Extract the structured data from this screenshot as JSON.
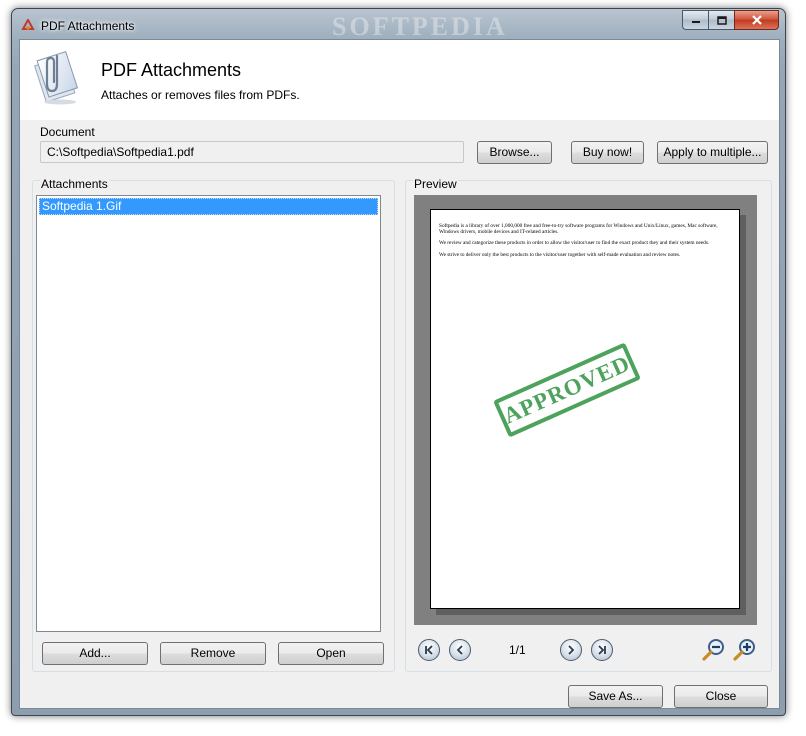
{
  "window": {
    "title": "PDF Attachments",
    "watermark": "SOFTPEDIA"
  },
  "header": {
    "title": "PDF Attachments",
    "subtitle": "Attaches or removes files from PDFs.",
    "icon": "paperclip-document-icon"
  },
  "document": {
    "label": "Document",
    "path": "C:\\Softpedia\\Softpedia1.pdf",
    "browse_label": "Browse...",
    "buy_label": "Buy now!",
    "apply_label": "Apply to multiple..."
  },
  "attachments": {
    "label": "Attachments",
    "items": [
      "Softpedia 1.Gif"
    ],
    "selected_index": 0,
    "add_label": "Add...",
    "remove_label": "Remove",
    "open_label": "Open"
  },
  "preview": {
    "label": "Preview",
    "page_indicator": "1/1",
    "page_paragraphs": [
      "Softpedia is a library of over 1,000,000 free and free-to-try software programs for Windows and Unix/Linux, games, Mac software, Windows drivers, mobile devices and IT-related articles.",
      "We review and categorize these products in order to allow the visitor/user to find the exact product they and their system needs.",
      "We strive to deliver only the best products to the visitor/user together with self-made evaluation and review notes."
    ],
    "stamp_text": "APPROVED",
    "stamp_color": "#3e9b4f"
  },
  "footer": {
    "save_as_label": "Save As...",
    "close_label": "Close"
  },
  "colors": {
    "selection": "#3399ff",
    "preview_background": "#808080",
    "close_button": "#c23a1f"
  }
}
